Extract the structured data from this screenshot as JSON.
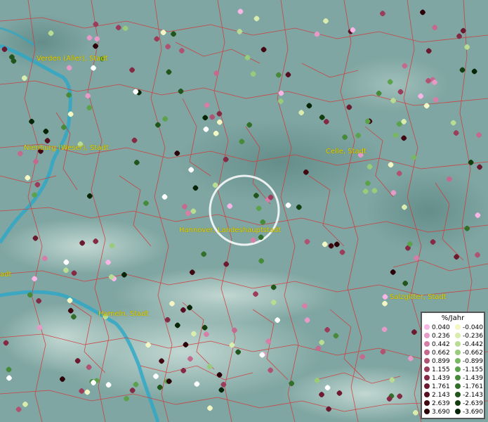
{
  "legend": {
    "title": "%/Jahr",
    "positive": [
      {
        "label": "0.040",
        "color": "#f7b6e6"
      },
      {
        "label": "0.236",
        "color": "#e69ac8"
      },
      {
        "label": "0.442",
        "color": "#d67ea8"
      },
      {
        "label": "0.662",
        "color": "#c46a8e"
      },
      {
        "label": "0.899",
        "color": "#b05272"
      },
      {
        "label": "1.155",
        "color": "#9a3c5a"
      },
      {
        "label": "1.439",
        "color": "#842a44"
      },
      {
        "label": "1.761",
        "color": "#6c1a30"
      },
      {
        "label": "2.143",
        "color": "#561020"
      },
      {
        "label": "2.639",
        "color": "#420812"
      },
      {
        "label": "3.690",
        "color": "#2a0208"
      }
    ],
    "negative": [
      {
        "label": "-0.040",
        "color": "#f4f7c4"
      },
      {
        "label": "-0.236",
        "color": "#d8ecae"
      },
      {
        "label": "-0.442",
        "color": "#b8dc92"
      },
      {
        "label": "-0.662",
        "color": "#98cc7a"
      },
      {
        "label": "-0.899",
        "color": "#78b862"
      },
      {
        "label": "-1.155",
        "color": "#5ca24c"
      },
      {
        "label": "-1.439",
        "color": "#468a3a"
      },
      {
        "label": "-1.761",
        "color": "#32702a"
      },
      {
        "label": "-2.143",
        "color": "#20561c"
      },
      {
        "label": "-2.639",
        "color": "#123e10"
      },
      {
        "label": "-3.690",
        "color": "#062406"
      }
    ]
  },
  "cities": {
    "verden": "Verden (Aller), Stadt",
    "nienburg": "Nienburg (Weser), Stadt",
    "celle": "Celle, Stadt",
    "hannover": "Hannover, Landeshauptstadt",
    "salzgitter": "Salzgitter, Stadt",
    "hameln": "Hameln, Stadt",
    "partial_west": "adt"
  },
  "colors": {
    "background": "#7fa6a2",
    "boundary": "#d23a3a",
    "river": "#2aa8c8",
    "city_label": "#e8d400"
  }
}
